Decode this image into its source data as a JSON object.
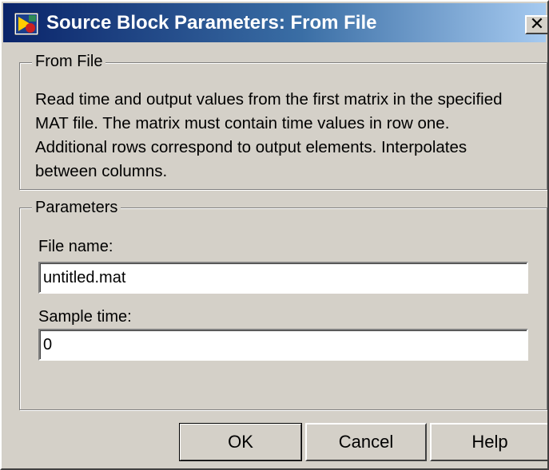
{
  "window": {
    "title": "Source Block Parameters: From File",
    "close_glyph": "✕",
    "icon": "simulink-block-icon"
  },
  "from_file_group": {
    "legend": "From File",
    "description_lines": [
      "Read time and output values from the first matrix in the specified",
      "MAT file.  The matrix must contain time values in row one.",
      "Additional rows correspond to output elements.  Interpolates",
      "between columns."
    ]
  },
  "parameters_group": {
    "legend": "Parameters",
    "file_name_label": "File name:",
    "file_name_value": "untitled.mat",
    "sample_time_label": "Sample time:",
    "sample_time_value": "0"
  },
  "buttons": {
    "ok": "OK",
    "cancel": "Cancel",
    "help": "Help"
  },
  "colors": {
    "title_gradient_start": "#0a246a",
    "title_gradient_end": "#a6caf0",
    "dialog_face": "#d4d0c8"
  }
}
